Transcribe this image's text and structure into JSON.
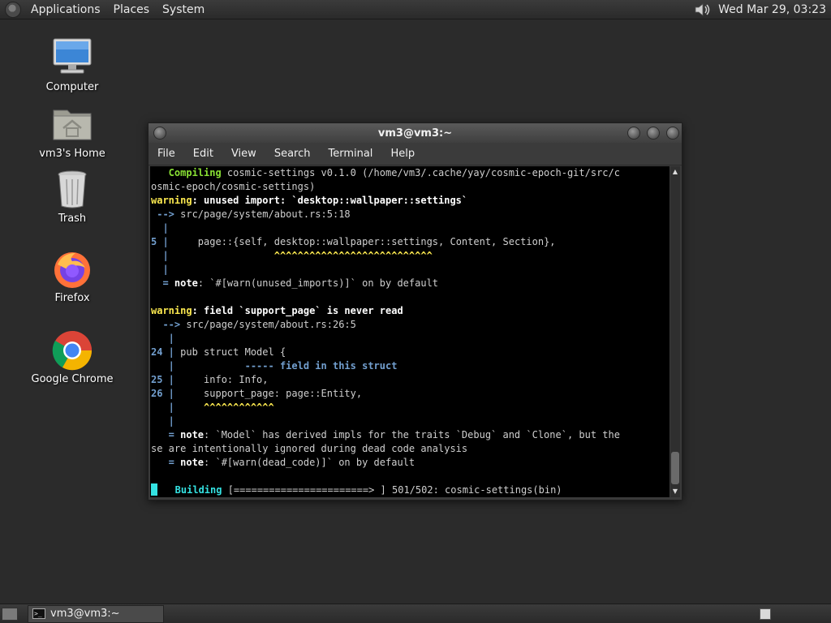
{
  "top_panel": {
    "menus": [
      "Applications",
      "Places",
      "System"
    ],
    "clock": "Wed Mar 29, 03:23"
  },
  "desktop_icons": [
    {
      "label": "Computer",
      "icon": "computer-icon"
    },
    {
      "label": "vm3's Home",
      "icon": "home-folder-icon"
    },
    {
      "label": "Trash",
      "icon": "trash-icon"
    },
    {
      "label": "Firefox",
      "icon": "firefox-icon"
    },
    {
      "label": "Google Chrome",
      "icon": "chrome-icon"
    }
  ],
  "window": {
    "title": "vm3@vm3:~",
    "menus": [
      "File",
      "Edit",
      "View",
      "Search",
      "Terminal",
      "Help"
    ]
  },
  "terminal": {
    "lines": [
      {
        "segs": [
          {
            "c": "g",
            "t": "   Compiling"
          },
          {
            "c": "",
            "t": " cosmic-settings v0.1.0 (/home/vm3/.cache/yay/cosmic-epoch-git/src/c"
          }
        ]
      },
      {
        "segs": [
          {
            "c": "",
            "t": "osmic-epoch/cosmic-settings)"
          }
        ]
      },
      {
        "segs": [
          {
            "c": "y",
            "t": "warning"
          },
          {
            "c": "w",
            "t": ": unused import: `desktop::wallpaper::settings`"
          }
        ]
      },
      {
        "segs": [
          {
            "c": "b",
            "t": " -->"
          },
          {
            "c": "",
            "t": " src/page/system/about.rs:5:18"
          }
        ]
      },
      {
        "segs": [
          {
            "c": "b",
            "t": "  |"
          }
        ]
      },
      {
        "segs": [
          {
            "c": "b",
            "t": "5 |"
          },
          {
            "c": "",
            "t": "     page::{self, desktop::wallpaper::settings, Content, Section},"
          }
        ]
      },
      {
        "segs": [
          {
            "c": "b",
            "t": "  |"
          },
          {
            "c": "y",
            "t": "                  ^^^^^^^^^^^^^^^^^^^^^^^^^^^"
          }
        ]
      },
      {
        "segs": [
          {
            "c": "b",
            "t": "  |"
          }
        ]
      },
      {
        "segs": [
          {
            "c": "b",
            "t": "  ="
          },
          {
            "c": "w",
            "t": " note"
          },
          {
            "c": "",
            "t": ": `#[warn(unused_imports)]` on by default"
          }
        ]
      },
      {
        "segs": [
          {
            "c": "",
            "t": ""
          }
        ]
      },
      {
        "segs": [
          {
            "c": "y",
            "t": "warning"
          },
          {
            "c": "w",
            "t": ": field `support_page` is never read"
          }
        ]
      },
      {
        "segs": [
          {
            "c": "b",
            "t": "  -->"
          },
          {
            "c": "",
            "t": " src/page/system/about.rs:26:5"
          }
        ]
      },
      {
        "segs": [
          {
            "c": "b",
            "t": "   |"
          }
        ]
      },
      {
        "segs": [
          {
            "c": "b",
            "t": "24 |"
          },
          {
            "c": "",
            "t": " pub struct Model {"
          }
        ]
      },
      {
        "segs": [
          {
            "c": "b",
            "t": "   |"
          },
          {
            "c": "b",
            "t": "            ----- field in this struct"
          }
        ]
      },
      {
        "segs": [
          {
            "c": "b",
            "t": "25 |"
          },
          {
            "c": "",
            "t": "     info: Info,"
          }
        ]
      },
      {
        "segs": [
          {
            "c": "b",
            "t": "26 |"
          },
          {
            "c": "",
            "t": "     support_page: page::Entity,"
          }
        ]
      },
      {
        "segs": [
          {
            "c": "b",
            "t": "   |"
          },
          {
            "c": "y",
            "t": "     ^^^^^^^^^^^^"
          }
        ]
      },
      {
        "segs": [
          {
            "c": "b",
            "t": "   |"
          }
        ]
      },
      {
        "segs": [
          {
            "c": "b",
            "t": "   ="
          },
          {
            "c": "w",
            "t": " note"
          },
          {
            "c": "",
            "t": ": `Model` has derived impls for the traits `Debug` and `Clone`, but the"
          }
        ]
      },
      {
        "segs": [
          {
            "c": "",
            "t": "se are intentionally ignored during dead code analysis"
          }
        ]
      },
      {
        "segs": [
          {
            "c": "b",
            "t": "   ="
          },
          {
            "c": "w",
            "t": " note"
          },
          {
            "c": "",
            "t": ": `#[warn(dead_code)]` on by default"
          }
        ]
      },
      {
        "segs": [
          {
            "c": "",
            "t": ""
          }
        ]
      },
      {
        "segs": [
          {
            "c": "cursor",
            "t": ""
          },
          {
            "c": "c",
            "t": "   Building"
          },
          {
            "c": "",
            "t": " [=======================> ] 501/502: cosmic-settings(bin)"
          }
        ]
      }
    ]
  },
  "taskbar": {
    "task_label": "vm3@vm3:~"
  }
}
